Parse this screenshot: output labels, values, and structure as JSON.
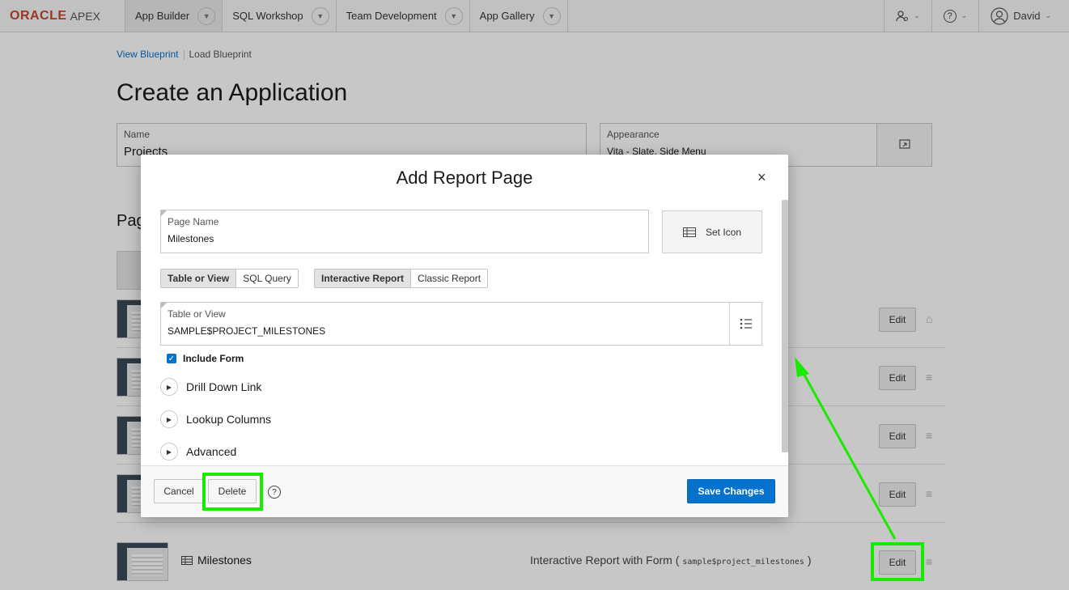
{
  "topnav": {
    "brand": "ORACLE",
    "product": "APEX",
    "tabs": [
      {
        "label": "App Builder",
        "active": true
      },
      {
        "label": "SQL Workshop"
      },
      {
        "label": "Team Development"
      },
      {
        "label": "App Gallery"
      }
    ],
    "user": "David",
    "icons": [
      "admin-icon",
      "help-icon",
      "user-avatar-icon"
    ]
  },
  "breadcrumb": {
    "items": [
      "View Blueprint",
      "Load Blueprint"
    ]
  },
  "page": {
    "title": "Create an Application",
    "name_field": {
      "label": "Name",
      "value": "Projects"
    },
    "appearance_field": {
      "label": "Appearance",
      "value": "Vita - Slate, Side Menu"
    },
    "pages_heading": "Pag"
  },
  "page_rows": [
    {
      "edit": "Edit",
      "icon": "home-icon"
    },
    {
      "edit": "Edit",
      "icon": "drag-handle-icon"
    },
    {
      "edit": "Edit",
      "icon": "drag-handle-icon"
    },
    {
      "edit": "Edit",
      "icon": "drag-handle-icon"
    },
    {
      "edit": "Edit",
      "icon": "drag-handle-icon",
      "name": "Milestones",
      "desc": "Interactive Report with Form (",
      "desc_code": "sample$project_milestones",
      "desc_end": ")"
    }
  ],
  "modal": {
    "title": "Add Report Page",
    "page_name": {
      "label": "Page Name",
      "value": "Milestones"
    },
    "set_icon": "Set Icon",
    "source_options": [
      "Table or View",
      "SQL Query"
    ],
    "source_selected": "Table or View",
    "report_options": [
      "Interactive Report",
      "Classic Report"
    ],
    "report_selected": "Interactive Report",
    "table_field": {
      "label": "Table or View",
      "value": "SAMPLE$PROJECT_MILESTONES"
    },
    "include_form": {
      "label": "Include Form",
      "checked": true
    },
    "sections": [
      "Drill Down Link",
      "Lookup Columns",
      "Advanced"
    ],
    "buttons": {
      "cancel": "Cancel",
      "delete": "Delete",
      "save": "Save Changes"
    }
  },
  "colors": {
    "accent": "#0572ce",
    "highlight": "#1aea00",
    "brand": "#c74634"
  }
}
